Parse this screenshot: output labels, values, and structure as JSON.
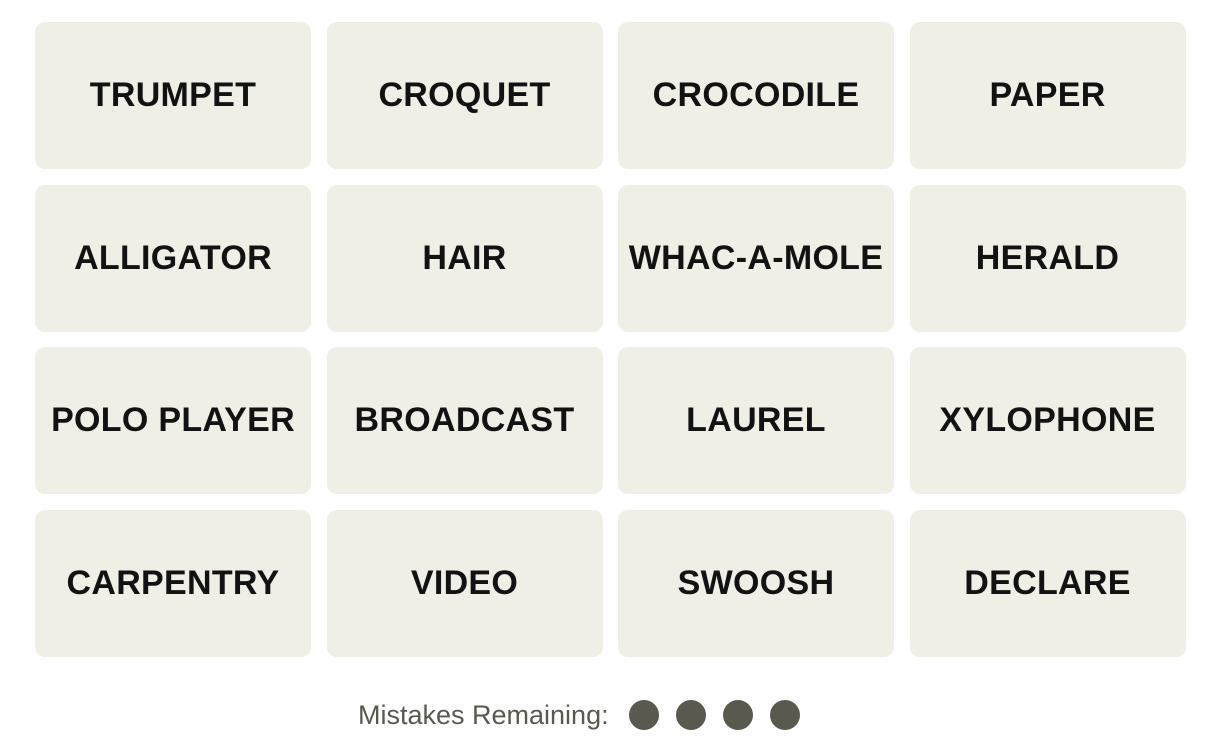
{
  "board": {
    "tiles": [
      "TRUMPET",
      "CROQUET",
      "CROCODILE",
      "PAPER",
      "ALLIGATOR",
      "HAIR",
      "WHAC-A-MOLE",
      "HERALD",
      "POLO PLAYER",
      "BROADCAST",
      "LAUREL",
      "XYLOPHONE",
      "CARPENTRY",
      "VIDEO",
      "SWOOSH",
      "DECLARE"
    ]
  },
  "status": {
    "mistakes_label": "Mistakes Remaining:",
    "mistakes_remaining": 4,
    "dot_color": "#5a594e"
  },
  "colors": {
    "tile_bg": "#efefe6",
    "tile_text": "#121212"
  }
}
